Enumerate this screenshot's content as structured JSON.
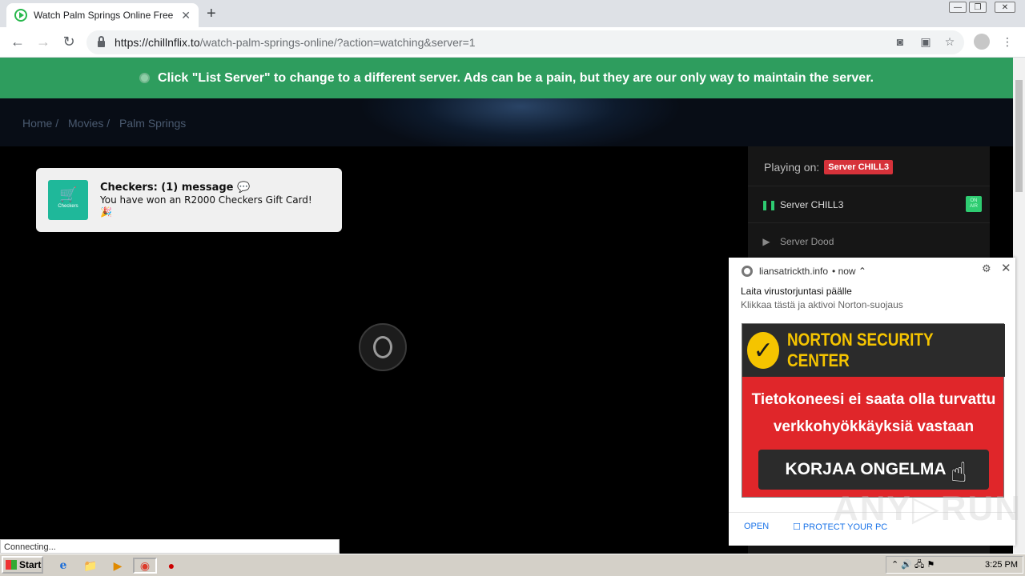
{
  "browser": {
    "tab_title": "Watch Palm Springs Online Free GoM",
    "tab_close": "✕",
    "new_tab": "+",
    "window_minimize": "—",
    "window_restore": "❐",
    "window_close": "✕",
    "url_host": "https://chillnflix.to",
    "url_path": "/watch-palm-springs-online/?action=watching&server=1",
    "back": "←",
    "forward": "→",
    "reload": "↻",
    "star": "☆",
    "menu": "⋮"
  },
  "page": {
    "banner": "Click \"List Server\" to change to a different server. Ads can be a pain, but they are our only way to maintain the server.",
    "breadcrumbs": [
      "Home /",
      "Movies /",
      "Palm Springs"
    ],
    "playing_on_label": "Playing on:",
    "playing_on_server": "Server CHILL3",
    "servers": [
      {
        "label": "Server CHILL3",
        "icon": "pause-icon",
        "glyph": "❚❚"
      },
      {
        "label": "Server Dood",
        "icon": "play-icon",
        "glyph": "▶"
      }
    ],
    "on_tag": "ON AIR"
  },
  "checkers_popup": {
    "title": "Checkers: (1) message 💬",
    "body": "You have won an R2000 Checkers Gift Card!",
    "extra": "🎉",
    "logo_text": "Checkers",
    "cart_icon": "🛒"
  },
  "notification": {
    "source": "liansatrickth.info",
    "time": "• now ⌃",
    "heading": "Laita virustorjuntasi päälle",
    "subtext": "Klikkaa tästä ja aktivoi Norton-suojaus",
    "ad_brand": "NORTON SECURITY CENTER",
    "ad_check": "✓",
    "ad_message_line1": "Tietokoneesi ei saata olla turvattu",
    "ad_message_line2": "verkkohyökkäyksiä vastaan",
    "ad_button": "KORJAA ONGELMA",
    "ad_hand": "☝",
    "open_label": "OPEN",
    "protect_label": "☐ PROTECT YOUR PC",
    "gear": "⚙",
    "close": "✕"
  },
  "watermark": "ANY▷RUN",
  "status_bar": "Connecting...",
  "taskbar": {
    "start_label": "Start",
    "apps": [
      "e",
      "📁",
      "▶",
      "◉",
      "●"
    ],
    "clock": "3:25 PM",
    "tray_icons": "⌃ 🔊 🖧 ⚑"
  },
  "colors": {
    "banner_green": "#2e9d5e",
    "server_badge_red": "#d6323a",
    "norton_red": "#e0262a",
    "norton_yellow": "#f5c400"
  }
}
